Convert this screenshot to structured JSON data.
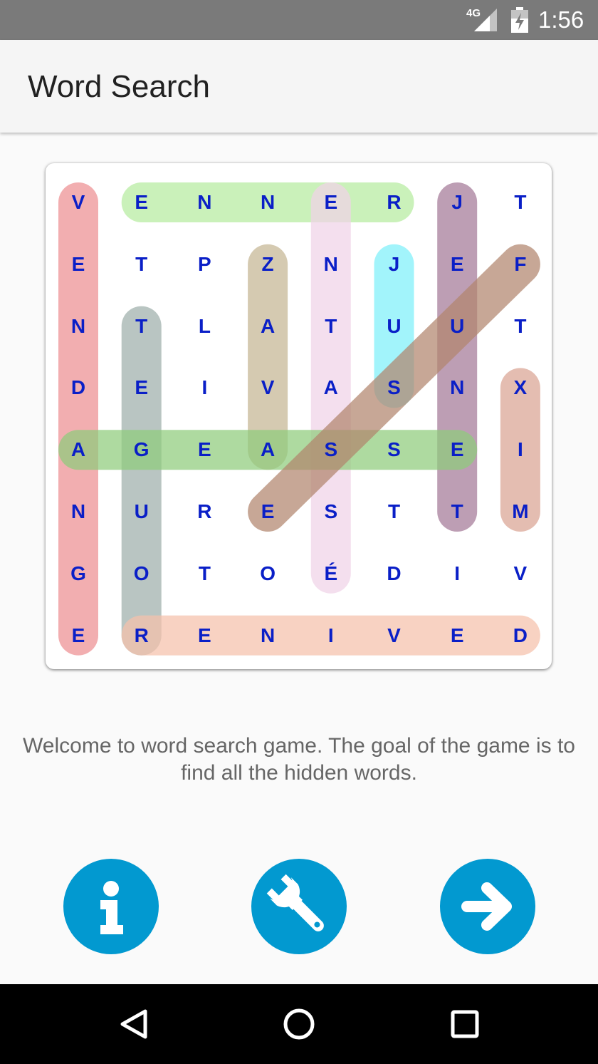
{
  "status_bar": {
    "network": "4G",
    "time": "1:56"
  },
  "app_bar": {
    "title": "Word Search"
  },
  "grid": {
    "rows": [
      [
        "V",
        "E",
        "N",
        "N",
        "E",
        "R",
        "J",
        "T"
      ],
      [
        "E",
        "T",
        "P",
        "Z",
        "N",
        "J",
        "E",
        "F"
      ],
      [
        "N",
        "T",
        "L",
        "A",
        "T",
        "U",
        "U",
        "T"
      ],
      [
        "D",
        "E",
        "I",
        "V",
        "A",
        "S",
        "N",
        "X"
      ],
      [
        "A",
        "G",
        "E",
        "A",
        "S",
        "S",
        "E",
        "I"
      ],
      [
        "N",
        "U",
        "R",
        "E",
        "S",
        "T",
        "T",
        "M"
      ],
      [
        "G",
        "O",
        "T",
        "O",
        "É",
        "D",
        "I",
        "V"
      ],
      [
        "E",
        "R",
        "E",
        "N",
        "I",
        "V",
        "E",
        "D"
      ]
    ],
    "highlights": [
      {
        "from": [
          0,
          0
        ],
        "to": [
          7,
          0
        ],
        "color": "#ee8f93"
      },
      {
        "from": [
          0,
          1
        ],
        "to": [
          0,
          5
        ],
        "color": "#b7eca0"
      },
      {
        "from": [
          0,
          6
        ],
        "to": [
          5,
          6
        ],
        "color": "#a57a98"
      },
      {
        "from": [
          1,
          3
        ],
        "to": [
          4,
          3
        ],
        "color": "#c6b694"
      },
      {
        "from": [
          0,
          4
        ],
        "to": [
          6,
          4
        ],
        "color": "#f1d3e8"
      },
      {
        "from": [
          1,
          5
        ],
        "to": [
          3,
          5
        ],
        "color": "#7ff0fa"
      },
      {
        "from": [
          2,
          1
        ],
        "to": [
          7,
          1
        ],
        "color": "#9fb0ab"
      },
      {
        "from": [
          3,
          7
        ],
        "to": [
          5,
          7
        ],
        "color": "#dba494"
      },
      {
        "from": [
          7,
          1
        ],
        "to": [
          7,
          7
        ],
        "color": "#f6c1ab"
      },
      {
        "from": [
          4,
          0
        ],
        "to": [
          4,
          6
        ],
        "color": "#8fcc7c"
      },
      {
        "from": [
          5,
          3
        ],
        "to": [
          1,
          7
        ],
        "color": "#b2866e"
      }
    ]
  },
  "welcome_text": "Welcome to word search game. The goal of the game is to find all the hidden words.",
  "buttons": [
    {
      "name": "info-button",
      "icon": "info-icon"
    },
    {
      "name": "settings-button",
      "icon": "wrench-icon"
    },
    {
      "name": "play-button",
      "icon": "arrow-right-icon"
    }
  ],
  "colors": {
    "accent": "#0299d0",
    "letter": "#0a1fc7",
    "status_bar": "#7a7a7a",
    "app_bar": "#f5f5f5"
  },
  "nav_bar": {
    "icons": [
      "back-icon",
      "home-icon",
      "recents-icon"
    ]
  }
}
